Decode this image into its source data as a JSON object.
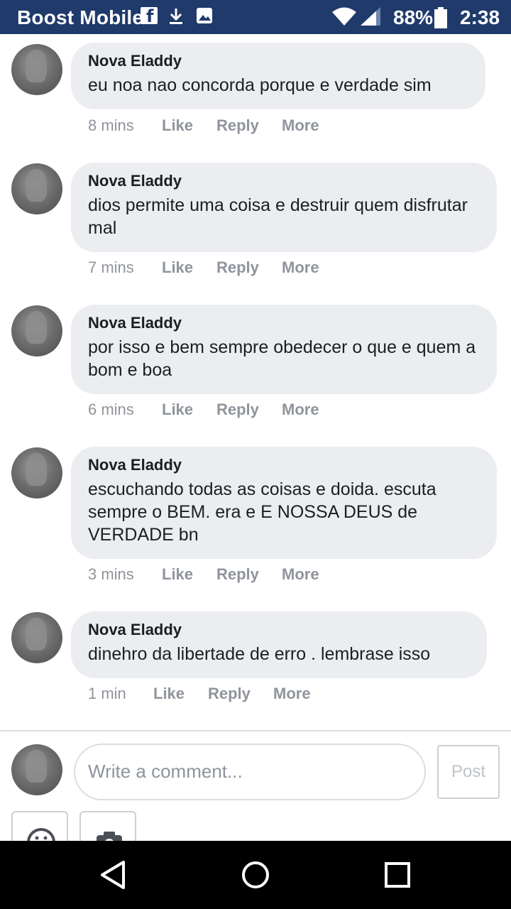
{
  "status_bar": {
    "carrier": "Boost Mobile",
    "battery": "88%",
    "time": "2:38",
    "icons": [
      "facebook-icon",
      "download-icon",
      "image-icon",
      "wifi-icon",
      "signal-icon",
      "battery-icon"
    ]
  },
  "action_labels": {
    "like": "Like",
    "reply": "Reply",
    "more": "More"
  },
  "comments": [
    {
      "author": "Nova Eladdy",
      "text": "eu noa nao concorda porque e verdade sim",
      "time": "8 mins"
    },
    {
      "author": "Nova Eladdy",
      "text": "dios permite uma coisa e destruir quem disfrutar mal",
      "time": "7 mins"
    },
    {
      "author": "Nova Eladdy",
      "text": "por isso e bem sempre obedecer o que e quem a bom e boa",
      "time": "6 mins"
    },
    {
      "author": "Nova Eladdy",
      "text": "escuchando todas as coisas e doida. escuta sempre o BEM. era e E NOSSA DEUS de VERDADE bn",
      "time": "3 mins"
    },
    {
      "author": "Nova Eladdy",
      "text": "dinehro da libertade de erro . lembrase isso",
      "time": "1 min"
    }
  ],
  "composer": {
    "placeholder": "Write a comment...",
    "post_label": "Post",
    "tools": [
      "emoji-icon",
      "camera-icon"
    ]
  },
  "nav_bar": {
    "buttons": [
      "back-icon",
      "home-icon",
      "recent-apps-icon"
    ]
  },
  "colors": {
    "status_bar": "#1f3a6b",
    "bubble": "#ebedf0",
    "text": "#1c1e21",
    "meta": "#90949c"
  }
}
